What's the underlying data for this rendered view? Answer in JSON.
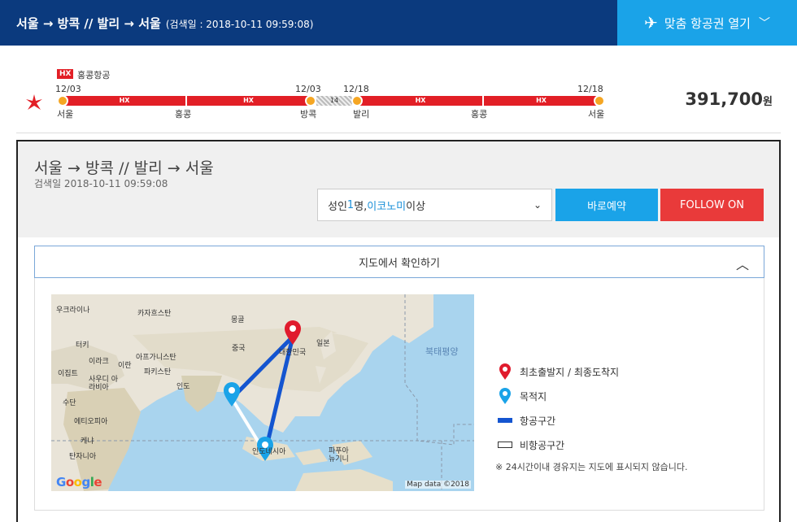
{
  "header": {
    "title": "서울 → 방콕 // 발리 → 서울",
    "search_date": "(검색일 : 2018-10-11 09:59:08)",
    "open_button": "맞춤 항공권 열기"
  },
  "itinerary": {
    "airline_code": "HX",
    "airline_name": "홍콩항공",
    "dates": [
      "12/03",
      "12/03",
      "12/18",
      "12/18"
    ],
    "cities": [
      "서울",
      "홍콩",
      "방콕",
      "발리",
      "홍콩",
      "서울"
    ],
    "segments": [
      "HX",
      "HX",
      "HX",
      "HX"
    ],
    "stay_days": "14",
    "price": "391,700",
    "currency": "원"
  },
  "detail": {
    "route_title": "서울 → 방콕 // 발리 → 서울",
    "search_date": "검색일 2018-10-11 09:59:08",
    "pax_prefix": "성인 ",
    "pax_count": "1",
    "pax_mid": "명, ",
    "pax_class": "이코노미",
    "pax_suffix": " 이상",
    "book_button": "바로예약",
    "follow_button": "FOLLOW ON",
    "map_toggle": "지도에서 확인하기"
  },
  "map": {
    "labels": [
      "우크라이나",
      "카자흐스탄",
      "몽골",
      "터키",
      "이라크",
      "이란",
      "아프가니스탄",
      "중국",
      "대한민국",
      "일본",
      "이집트",
      "사우디 아라비아",
      "파키스탄",
      "인도",
      "수단",
      "에티오피아",
      "케냐",
      "탄자니아",
      "인도네시아",
      "파푸아 뉴기니"
    ],
    "ocean_label": "북태평양",
    "credit": "Map data ©2018",
    "logo": "Google"
  },
  "legend": {
    "origin": "최초출발지 / 최종도착지",
    "destination": "목적지",
    "flight_leg": "항공구간",
    "non_flight_leg": "비항공구간",
    "note": "※ 24시간이내 경유지는 지도에 표시되지 않습니다."
  },
  "colors": {
    "header_bg": "#0b3a7e",
    "accent_blue": "#1aa3e8",
    "accent_red": "#e93a3a",
    "route_blue": "#1455d0"
  }
}
